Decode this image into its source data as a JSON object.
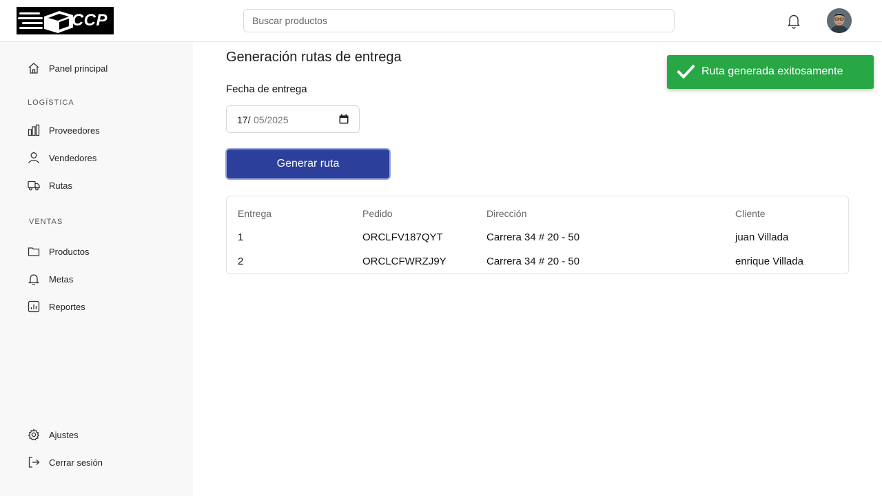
{
  "header": {
    "logo_text": "CCP",
    "search_placeholder": "Buscar productos"
  },
  "sidebar": {
    "home": "Panel principal",
    "section_logistica": "LOGÍSTICA",
    "logistica_items": [
      "Proveedores",
      "Vendedores",
      "Rutas"
    ],
    "section_ventas": "VENTAS",
    "ventas_items": [
      "Productos",
      "Metas",
      "Reportes"
    ],
    "settings": "Ajustes",
    "logout": "Cerrar sesión"
  },
  "main": {
    "title": "Generación rutas de entrega",
    "date_label": "Fecha de entrega",
    "date_day": "17/",
    "date_rest": "05/2025",
    "button_label": "Generar ruta",
    "table": {
      "headers": [
        "Entrega",
        "Pedido",
        "Dirección",
        "Cliente"
      ],
      "rows": [
        [
          "1",
          "ORCLFV187QYT",
          "Carrera 34 # 20 - 50",
          "juan Villada"
        ],
        [
          "2",
          "ORCLCFWRZJ9Y",
          "Carrera 34 # 20 - 50",
          "enrique Villada"
        ]
      ]
    }
  },
  "toast": {
    "message": "Ruta generada exitosamente",
    "color": "#28a745"
  },
  "colors": {
    "primary_button": "#2c409b",
    "sidebar_bg": "#f8f8f8"
  }
}
